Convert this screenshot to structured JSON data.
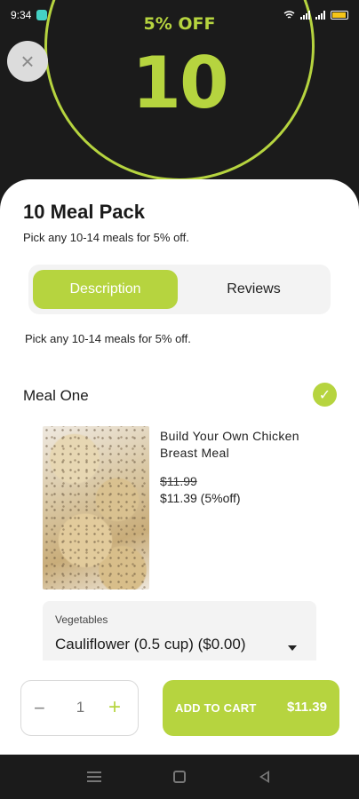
{
  "status_bar": {
    "time": "9:34"
  },
  "hero": {
    "discount_label": "5% OFF",
    "pack_size": "10"
  },
  "close": {
    "icon": "close-icon",
    "glyph": "×"
  },
  "pack": {
    "title": "10 Meal Pack",
    "subtitle": "Pick any 10-14 meals for 5% off.",
    "description": "Pick any 10-14 meals for 5% off."
  },
  "tabs": [
    {
      "label": "Description",
      "active": true
    },
    {
      "label": "Reviews",
      "active": false
    }
  ],
  "meal": {
    "label": "Meal One",
    "selected": true,
    "check_glyph": "✓",
    "name": "Build Your Own Chicken Breast Meal",
    "price_original": "$11.99",
    "price_discounted": "$11.39 (5%off)"
  },
  "vegetables": {
    "label": "Vegetables",
    "selected": "Cauliflower (0.5 cup) ($0.00)"
  },
  "quantity": {
    "minus": "−",
    "value": "1",
    "plus": "+"
  },
  "cart": {
    "label": "ADD TO CART",
    "price": "$11.39"
  },
  "colors": {
    "accent": "#b6d43f",
    "background": "#1b1b1b",
    "sheet": "#ffffff"
  }
}
